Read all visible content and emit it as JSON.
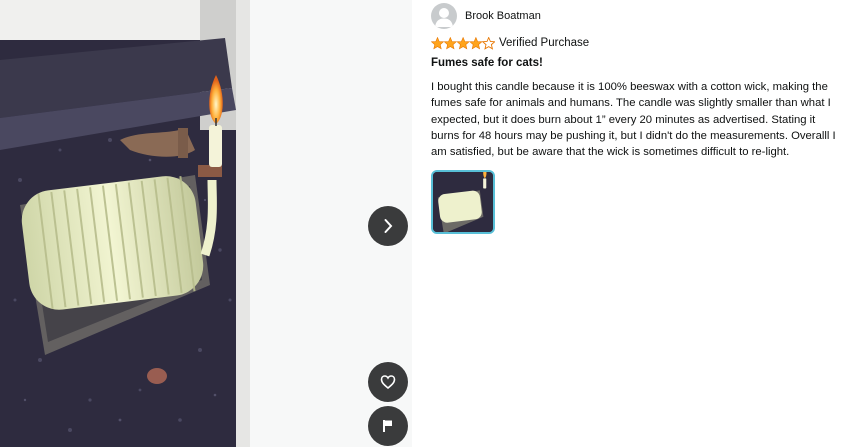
{
  "review": {
    "author": "Brook Boatman",
    "rating": 4,
    "rating_max": 5,
    "verified_label": "Verified Purchase",
    "title": "Fumes safe for cats!",
    "body": "I bought this candle because it is 100% beeswax with a cotton wick, making the fumes safe for animals and humans. The candle was slightly smaller than what I expected, but it does burn about 1” every 20 minutes as advertised. Stating it burns for 48 hours may be pushing it, but I didn't do the measurements. Overalll I am satisfied, but be aware that the wick is sometimes difficult to re-light."
  },
  "media": {
    "thumbnail_count": 1,
    "selected_thumbnail": 0
  },
  "icons": {
    "next": "chevron-right-icon",
    "like": "heart-icon",
    "report": "flag-icon",
    "avatar": "user-silhouette-icon"
  },
  "colors": {
    "star": "#ffa41c",
    "thumb_border": "#58bfd7",
    "round_button": "#3a3b3c"
  }
}
